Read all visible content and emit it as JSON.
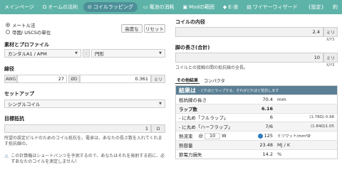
{
  "nav": {
    "items": [
      {
        "label": "メインページ",
        "icon": ""
      },
      {
        "label": "オームの法則",
        "icon": "Ω"
      },
      {
        "label": "コイルラッピング",
        "icon": "⊙"
      },
      {
        "label": "電池の消耗",
        "icon": "▭"
      },
      {
        "label": "Modの範囲",
        "icon": "▣"
      },
      {
        "label": "E-液",
        "icon": "◆"
      },
      {
        "label": "ワイヤーウィザード",
        "icon": "▤"
      }
    ],
    "settings_label": "{設定}",
    "lang_label": "約"
  },
  "units": {
    "metric": "メートル法",
    "imperial": "帝国/ USCSの単位"
  },
  "buttons": {
    "advanced": "高度な",
    "reset": "リセット"
  },
  "material": {
    "label": "素材とプロファイル",
    "material_value": "カンタルA1 / APM",
    "sep": ":",
    "profile_value": "円形"
  },
  "wire": {
    "label": "線径",
    "awg_addon": "AWG",
    "awg_value": "27",
    "dia_addon": "ØD",
    "dia_value": "0.361",
    "unit": "ミリ"
  },
  "setup": {
    "label": "セットアップ",
    "value": "シングルコイル"
  },
  "target": {
    "label": "目標抵抗",
    "value": "1",
    "unit": "Ω",
    "note": "所望の設定ピルドのためのコイル抵抗を。電卓は、あなたの長さ数を入れてくれます抵抗線の。"
  },
  "warning": "この計算機はショートバンツを予測するので、あなたはそれを発射する前に、必ずあなたのコイルを測定しません！",
  "coil_diameter": {
    "label": "コイルの内径",
    "value": "2.4",
    "unit": "ミリ",
    "sub": "X/Y3"
  },
  "leg_length": {
    "label": "脚の長さ(合計)",
    "value": "10",
    "unit": "ミリ",
    "sub": "X/Y3",
    "note": "コイルとの接触の間の抵抗線の全長。"
  },
  "result_tabs": [
    "その他結果",
    "コンパクタ"
  ],
  "results": {
    "title": "結果は",
    "subtitle": "- どれほどラップする、それがどれほど抵抗します",
    "rows": [
      {
        "k": "抵抗線の長さ",
        "v": "70.4",
        "u": "mm",
        "x": ""
      },
      {
        "k": "ラップ数",
        "v": "6.16",
        "u": "",
        "x": ""
      },
      {
        "k": "- に丸め「フルラップ」",
        "v": "6",
        "u": "",
        "x": "(1.78Ω) 0.98"
      },
      {
        "k": "- に丸め「ハーフラップ」",
        "v": "7/6",
        "u": "",
        "x": "(1.84Ω)1.05"
      },
      {
        "k": "熱流束",
        "v": "125",
        "u": "ミリワット/mm²Ø",
        "x": ""
      },
      {
        "k": "熱容量",
        "v": "23.48",
        "u": "MJ / K",
        "x": ""
      },
      {
        "k": "節電力損失",
        "v": "14.2",
        "u": "%",
        "x": ""
      }
    ],
    "heat_watts_prefix": "@",
    "heat_watts_value": "10",
    "heat_watts_unit": "W"
  }
}
